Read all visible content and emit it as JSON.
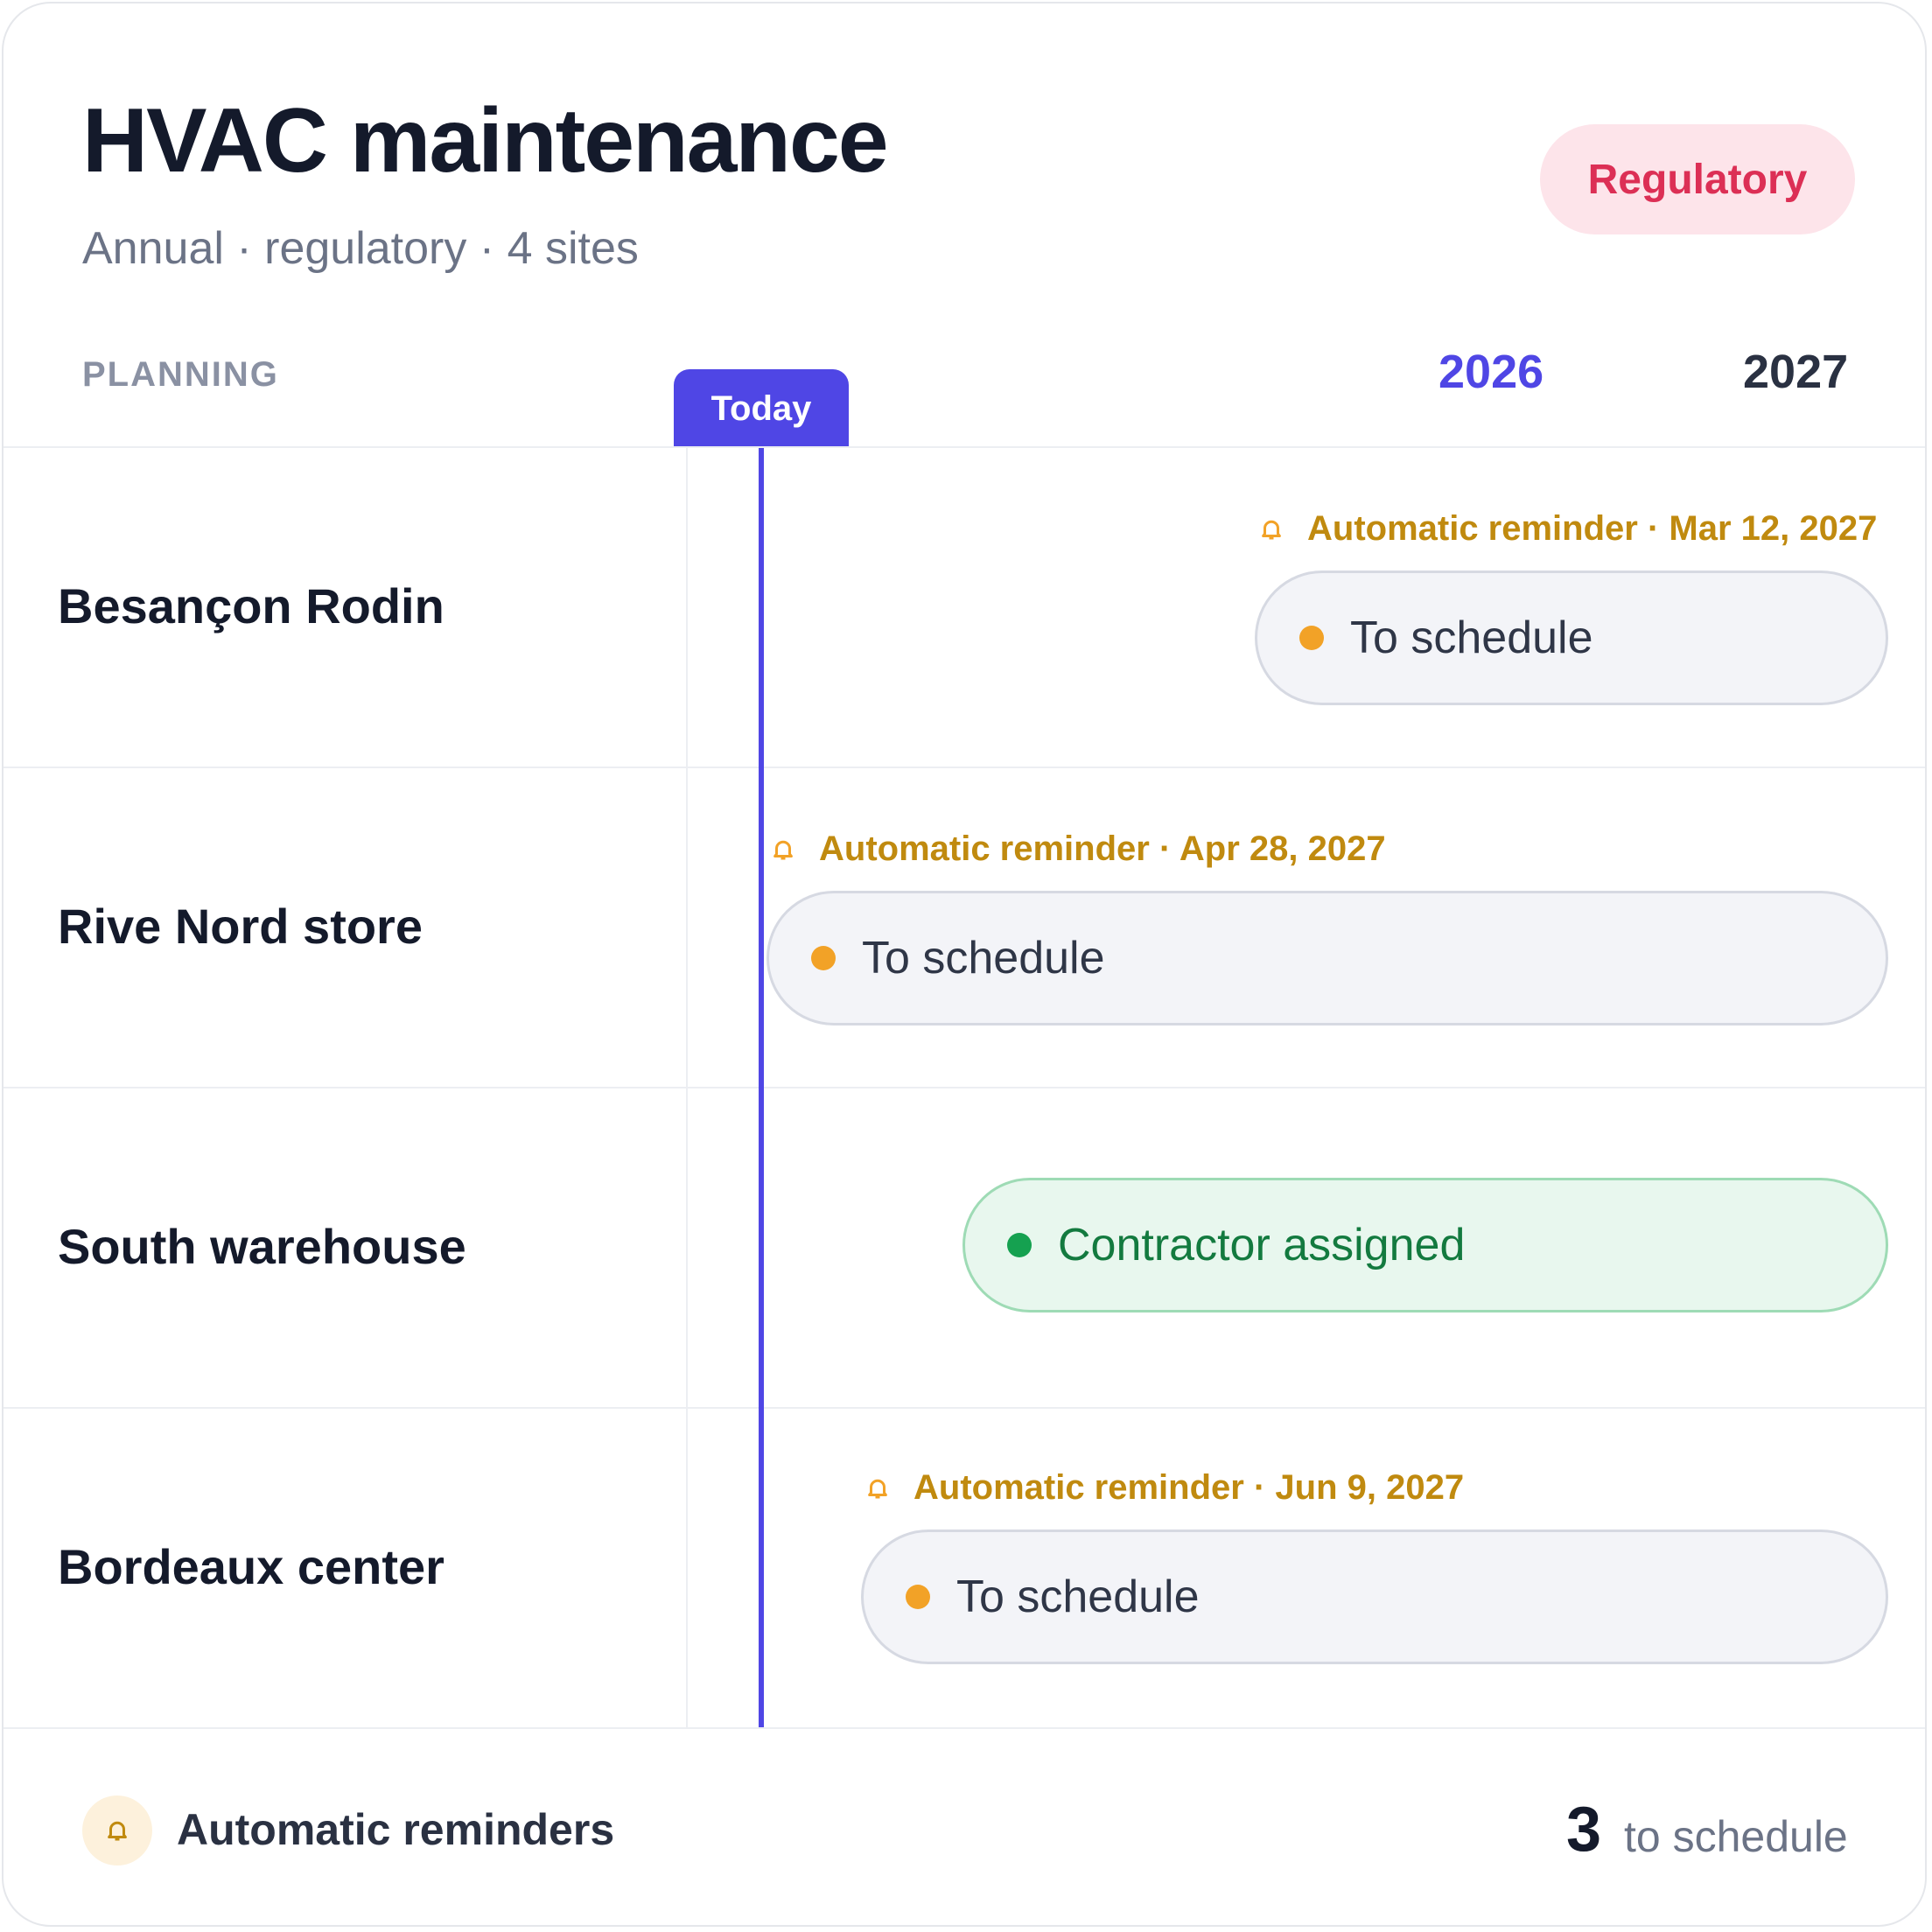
{
  "header": {
    "title": "HVAC maintenance",
    "subtitle": "Annual · regulatory · 4 sites",
    "badge": "Regulatory"
  },
  "timeline": {
    "planning_label": "PLANNING",
    "today_label": "Today",
    "years": [
      "2026",
      "2027"
    ]
  },
  "rows": [
    {
      "site": "Besançon Rodin",
      "reminder": "Automatic reminder · Mar 12, 2027",
      "status": "To schedule"
    },
    {
      "site": "Rive Nord store",
      "reminder": "Automatic reminder · Apr 28, 2027",
      "status": "To schedule"
    },
    {
      "site": "South warehouse",
      "status": "Contractor assigned"
    },
    {
      "site": "Bordeaux center",
      "reminder": "Automatic reminder · Jun 9, 2027",
      "status": "To schedule"
    }
  ],
  "footer": {
    "reminders_label": "Automatic reminders",
    "count": "3",
    "count_label": "to schedule"
  },
  "colors": {
    "accent": "#4f46e5",
    "regulatory": "#dc2f55",
    "reminder": "#c08a0f",
    "pending_dot": "#f2a227",
    "assigned": "#15a150"
  },
  "icons": {
    "reminder": "bell-icon"
  }
}
